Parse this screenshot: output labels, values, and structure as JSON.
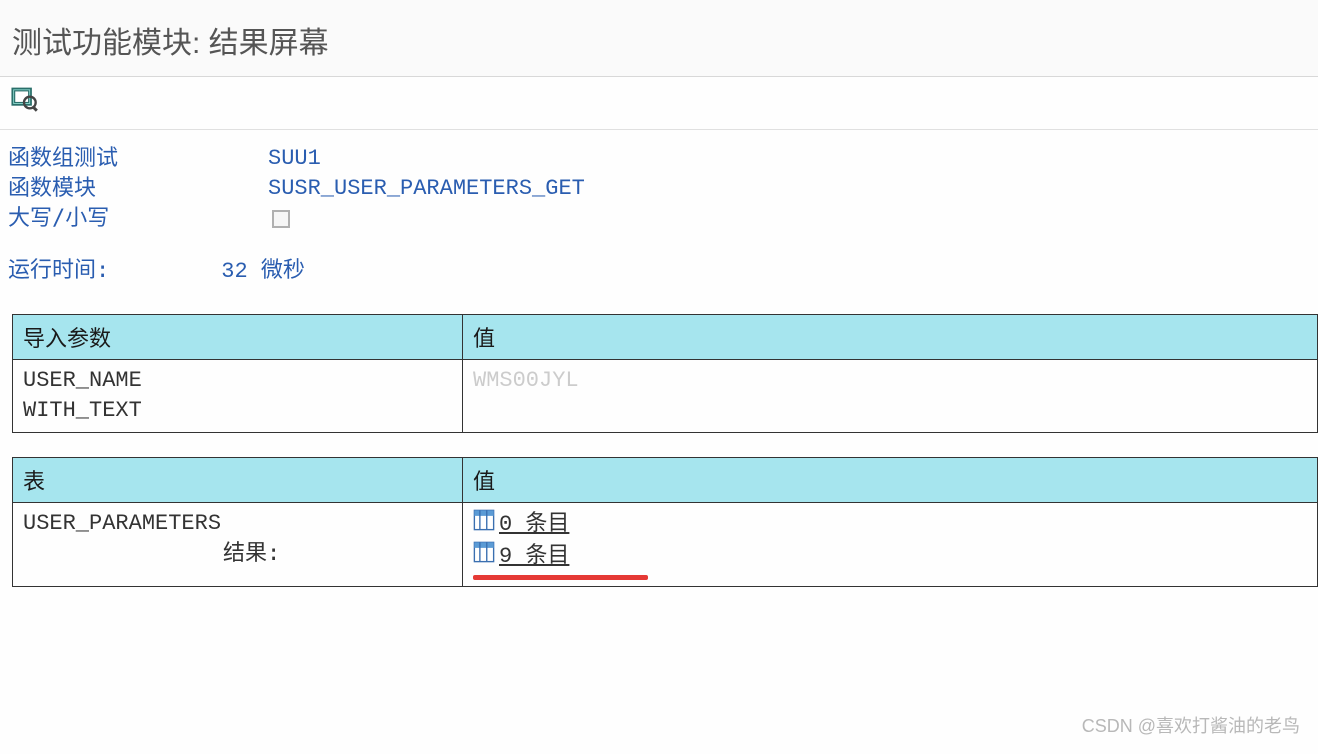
{
  "title": "测试功能模块: 结果屏幕",
  "info": {
    "group_label": "函数组测试",
    "group_value": "SUU1",
    "module_label": "函数模块",
    "module_value": "SUSR_USER_PARAMETERS_GET",
    "case_label": "大写/小写"
  },
  "runtime": {
    "label": "运行时间:",
    "value": "32",
    "unit": "微秒"
  },
  "import_table": {
    "header_param": "导入参数",
    "header_val": "值",
    "rows": {
      "p1": "USER_NAME",
      "p2": "WITH_TEXT",
      "v1": "WMS00JYL"
    }
  },
  "result_table": {
    "header_param": "表",
    "header_val": "值",
    "param_name": "USER_PARAMETERS",
    "result_label": "结果:",
    "entry0": "0 条目",
    "entry1": "9 条目"
  },
  "watermark": "CSDN @喜欢打酱油的老鸟"
}
